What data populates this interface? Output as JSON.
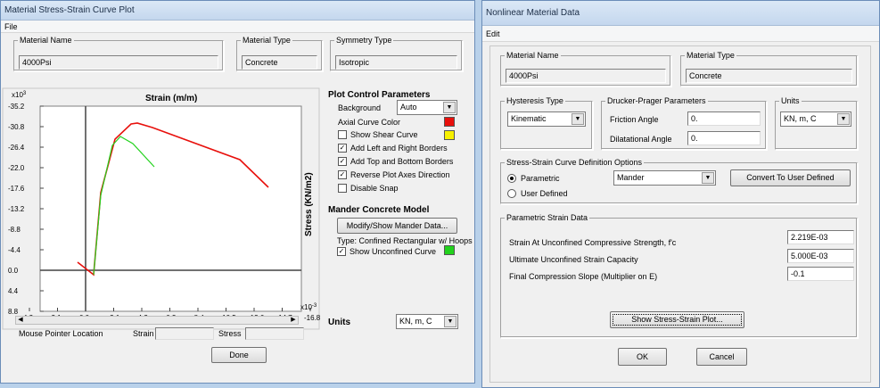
{
  "left_window": {
    "title": "Material Stress-Strain Curve Plot",
    "menu": [
      "File"
    ],
    "material_name": {
      "label": "Material Name",
      "value": "4000Psi"
    },
    "material_type": {
      "label": "Material Type",
      "value": "Concrete"
    },
    "symmetry_type": {
      "label": "Symmetry Type",
      "value": "Isotropic"
    },
    "plot": {
      "exponent_top": "x10",
      "exponent_top_sup": "3",
      "exponent_right": "x10",
      "exponent_right_sup": "-3",
      "x_title": "Strain  (m/m)",
      "y_title": "Stress  (KN/m2)",
      "y_ticks": [
        "-35.2",
        "-30.8",
        "-26.4",
        "-22.0",
        "-17.6",
        "-13.2",
        "-8.8",
        "-4.4",
        "0.0",
        "4.4",
        "8.8"
      ],
      "x_ticks": [
        "4.2",
        "2.1",
        "0.0",
        "-2.1",
        "-4.2",
        "-6.3",
        "-8.4",
        "-10.5",
        "-12.6",
        "-14.7",
        "-16.8"
      ]
    },
    "mouse_pointer_label": "Mouse Pointer Location",
    "strain_label": "Strain",
    "stress_label": "Stress",
    "done_button": "Done",
    "plot_control": {
      "header": "Plot Control Parameters",
      "background_label": "Background",
      "background_value": "Auto",
      "axial_color_label": "Axial Curve Color",
      "axial_color": "#e8100c",
      "shear_color": "#f7f000",
      "unconfined_color": "#22d21d",
      "show_shear": "Show Shear Curve",
      "add_lr": "Add Left and Right Borders",
      "add_tb": "Add Top and Bottom Borders",
      "reverse": "Reverse Plot Axes Direction",
      "disable_snap": "Disable Snap"
    },
    "mander": {
      "header": "Mander Concrete Model",
      "button": "Modify/Show Mander Data...",
      "type_text": "Type:  Confined Rectangular w/ Hoops",
      "show_unconfined": "Show Unconfined Curve"
    },
    "units_label": "Units",
    "units_value": "KN, m, C"
  },
  "right_window": {
    "title": "Nonlinear Material Data",
    "menu": [
      "Edit"
    ],
    "material_name": {
      "label": "Material Name",
      "value": "4000Psi"
    },
    "material_type": {
      "label": "Material Type",
      "value": "Concrete"
    },
    "hysteresis": {
      "label": "Hysteresis Type",
      "value": "Kinematic"
    },
    "drucker": {
      "label": "Drucker-Prager Parameters",
      "friction_label": "Friction Angle",
      "friction_value": "0.",
      "dilatational_label": "Dilatational Angle",
      "dilatational_value": "0."
    },
    "units": {
      "label": "Units",
      "value": "KN, m, C"
    },
    "curve_options": {
      "label": "Stress-Strain Curve Definition Options",
      "parametric": "Parametric",
      "user_defined": "User Defined",
      "model": "Mander",
      "convert_button": "Convert To User Defined"
    },
    "strain_data": {
      "label": "Parametric Strain Data",
      "rows": [
        {
          "label": "Strain At Unconfined Compressive Strength, f'c",
          "value": "2.219E-03"
        },
        {
          "label": "Ultimate Unconfined Strain Capacity",
          "value": "5.000E-03"
        },
        {
          "label": "Final Compression Slope (Multiplier on E)",
          "value": "-0.1"
        }
      ]
    },
    "show_plot_button": "Show Stress-Strain Plot...",
    "ok_button": "OK",
    "cancel_button": "Cancel"
  }
}
